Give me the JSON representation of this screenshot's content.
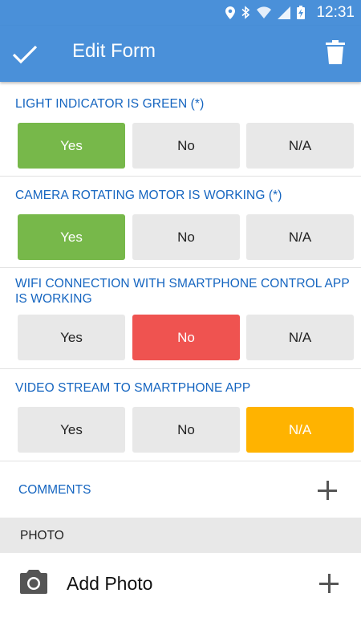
{
  "status_bar": {
    "time": "12:31",
    "icons": [
      "location-icon",
      "bluetooth-icon",
      "wifi-icon",
      "signal-icon",
      "battery-charging-icon"
    ]
  },
  "header": {
    "title": "Edit Form"
  },
  "questions": [
    {
      "label": "LIGHT INDICATOR IS GREEN (*)",
      "options": [
        "Yes",
        "No",
        "N/A"
      ],
      "selected": "Yes"
    },
    {
      "label": "CAMERA ROTATING MOTOR IS WORKING (*)",
      "options": [
        "Yes",
        "No",
        "N/A"
      ],
      "selected": "Yes"
    },
    {
      "label": "WIFI CONNECTION WITH SMARTPHONE CONTROL APP IS WORKING",
      "options": [
        "Yes",
        "No",
        "N/A"
      ],
      "selected": "No"
    },
    {
      "label": "VIDEO STREAM TO SMARTPHONE APP",
      "options": [
        "Yes",
        "No",
        "N/A"
      ],
      "selected": "N/A"
    }
  ],
  "comments": {
    "label": "COMMENTS"
  },
  "photo": {
    "section_label": "PHOTO",
    "add_label": "Add Photo"
  },
  "colors": {
    "appbar": "#4a90d9",
    "accent_text": "#1565c0",
    "yes_selected": "#77b84a",
    "no_selected": "#ef5350",
    "na_selected": "#ffb300",
    "unselected": "#e8e8e8"
  }
}
